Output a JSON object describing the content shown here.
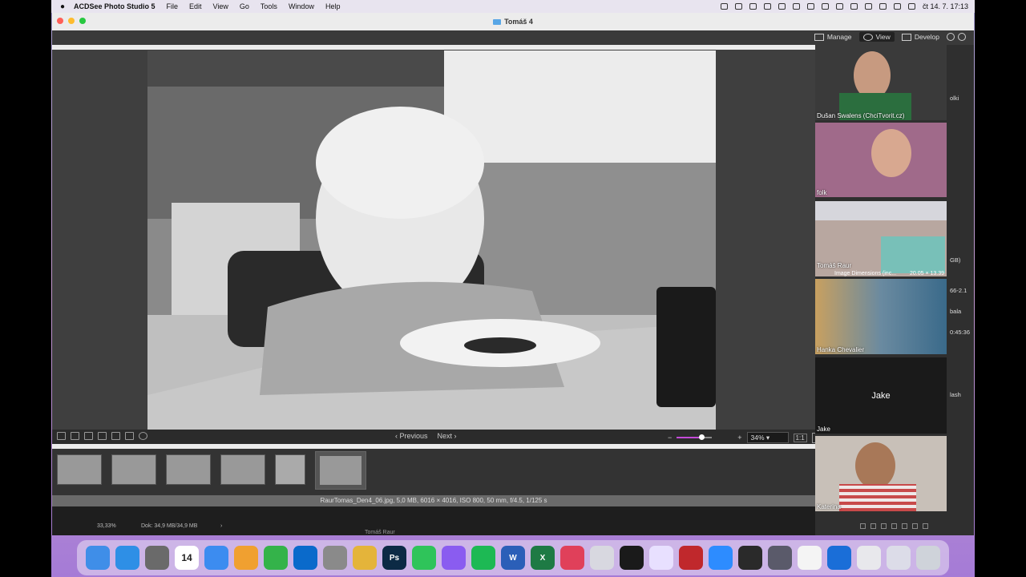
{
  "menubar": {
    "apple": "",
    "app_name": "ACDSee Photo Studio 5",
    "menus": [
      "File",
      "Edit",
      "View",
      "Go",
      "Tools",
      "Window",
      "Help"
    ],
    "clock": "čt 14. 7.  17:13"
  },
  "window": {
    "title": "Tomáš 4",
    "modes": [
      {
        "label": "Manage",
        "icon": "grid-icon"
      },
      {
        "label": "View",
        "icon": "eye-icon"
      },
      {
        "label": "Develop",
        "icon": "develop-icon"
      }
    ]
  },
  "viewer": {
    "prev_label": "Previous",
    "next_label": "Next",
    "zoom": "34%",
    "one_to_one": "1:1",
    "zoom_minus": "−",
    "zoom_plus": "+",
    "file_info": "RaurTomas_Den4_06.jpg, 5,0 MB, 6016 × 4016, ISO 800, 50 mm, f/4.5, 1/125 s",
    "thumbnail_count": 6
  },
  "bottombar": {
    "zoom_pct": "33,33%",
    "doc_info": "Dok: 34,9 MB/34,9 MB",
    "caret": "›",
    "partial_label": "Tomáš Raur"
  },
  "right_panel": {
    "partial_texts": [
      {
        "text": "olki"
      },
      {
        "text": "GB)"
      },
      {
        "text": "66-2.1"
      },
      {
        "text": "bala"
      },
      {
        "text": "0:45:36"
      },
      {
        "text": "lash"
      }
    ],
    "overlay_texts": [
      "Image Dimensions (inc...",
      "20.05 × 13.39"
    ],
    "participants": [
      {
        "name": "Dušan Swalens (ChciTvorit.cz)",
        "center": "",
        "color": "#3a3a3a"
      },
      {
        "name": "folk",
        "center": "",
        "color": "#a06a8a"
      },
      {
        "name": "Tomáš Raur",
        "center": "",
        "color": "#b8a7a0"
      },
      {
        "name": "Hanka Chevalier",
        "center": "",
        "color": "#5a7a8a"
      },
      {
        "name": "Jake",
        "center": "Jake",
        "color": "#1a1a1a"
      },
      {
        "name": "Katerina",
        "center": "",
        "color": "#c8c0b8"
      }
    ]
  },
  "dock": {
    "apps": [
      {
        "name": "finder-icon",
        "label": "",
        "color": "#3f8ee8"
      },
      {
        "name": "safari-icon",
        "label": "",
        "color": "#2e8fe6"
      },
      {
        "name": "scanner-icon",
        "label": "",
        "color": "#6a6a6a"
      },
      {
        "name": "calendar-icon",
        "label": "14",
        "color": "#ffffff"
      },
      {
        "name": "appstore-icon",
        "label": "",
        "color": "#3c8cf0"
      },
      {
        "name": "pages-icon",
        "label": "",
        "color": "#f0a030"
      },
      {
        "name": "numbers-icon",
        "label": "",
        "color": "#34b34a"
      },
      {
        "name": "outlook-icon",
        "label": "",
        "color": "#0a6acb"
      },
      {
        "name": "settings-icon",
        "label": "",
        "color": "#8a8a8a"
      },
      {
        "name": "chrome-icon",
        "label": "",
        "color": "#e4b43a"
      },
      {
        "name": "photoshop-icon",
        "label": "Ps",
        "color": "#0c2a45"
      },
      {
        "name": "whatsapp-icon",
        "label": "",
        "color": "#2fc45a"
      },
      {
        "name": "messenger-icon",
        "label": "",
        "color": "#8a5cf0"
      },
      {
        "name": "spotify-icon",
        "label": "",
        "color": "#1db954"
      },
      {
        "name": "word-icon",
        "label": "W",
        "color": "#2b5fb8"
      },
      {
        "name": "excel-icon",
        "label": "X",
        "color": "#1e7a44"
      },
      {
        "name": "speaker-icon",
        "label": "",
        "color": "#e0405a"
      },
      {
        "name": "mail-icon",
        "label": "",
        "color": "#d8d8e0"
      },
      {
        "name": "chatgpt-icon",
        "label": "",
        "color": "#1a1a1a"
      },
      {
        "name": "affinity-icon",
        "label": "",
        "color": "#e8e0ff"
      },
      {
        "name": "camera-raw-icon",
        "label": "",
        "color": "#c0282c"
      },
      {
        "name": "zoom-icon",
        "label": "",
        "color": "#2d8cff"
      },
      {
        "name": "obs-icon",
        "label": "",
        "color": "#2a2a2a"
      },
      {
        "name": "quicktime-icon",
        "label": "",
        "color": "#5a5a6a"
      },
      {
        "name": "textedit-icon",
        "label": "",
        "color": "#f4f4f4"
      },
      {
        "name": "teamviewer-icon",
        "label": "",
        "color": "#1a6ed8"
      },
      {
        "name": "document-icon",
        "label": "",
        "color": "#e8e8ec"
      },
      {
        "name": "preview-icon",
        "label": "",
        "color": "#dcdce8"
      },
      {
        "name": "trash-icon",
        "label": "",
        "color": "#cfd3da"
      }
    ]
  }
}
